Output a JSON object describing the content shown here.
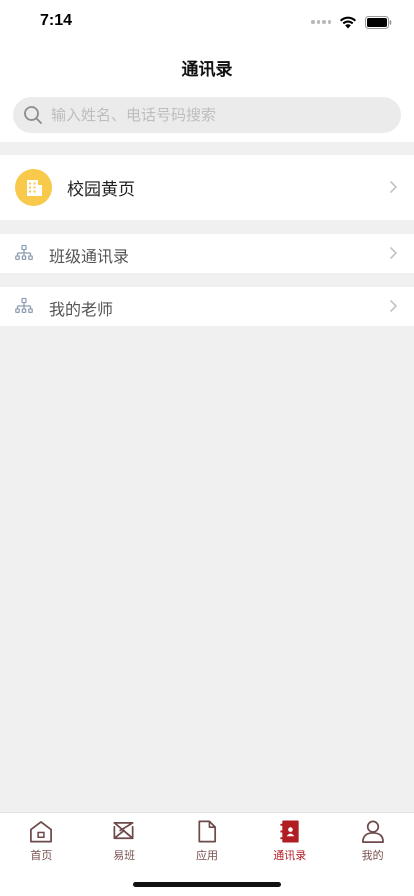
{
  "status_bar": {
    "time": "7:14"
  },
  "nav": {
    "title": "通讯录"
  },
  "search": {
    "placeholder": "输入姓名、电话号码搜索"
  },
  "rows": [
    {
      "label": "校园黄页",
      "icon": "building-icon"
    },
    {
      "label": "班级通讯录",
      "icon": "org-tree-icon"
    },
    {
      "label": "我的老师",
      "icon": "org-tree-icon"
    }
  ],
  "tabs": [
    {
      "label": "首页",
      "icon": "home-icon"
    },
    {
      "label": "易班",
      "icon": "yiban-icon"
    },
    {
      "label": "应用",
      "icon": "document-icon"
    },
    {
      "label": "通讯录",
      "icon": "contacts-book-icon",
      "active": true
    },
    {
      "label": "我的",
      "icon": "person-icon"
    }
  ],
  "colors": {
    "accent": "#b01e23",
    "tab_inactive": "#7a5050",
    "badge_yellow": "#f8c94a",
    "background": "#f0f0f0"
  }
}
